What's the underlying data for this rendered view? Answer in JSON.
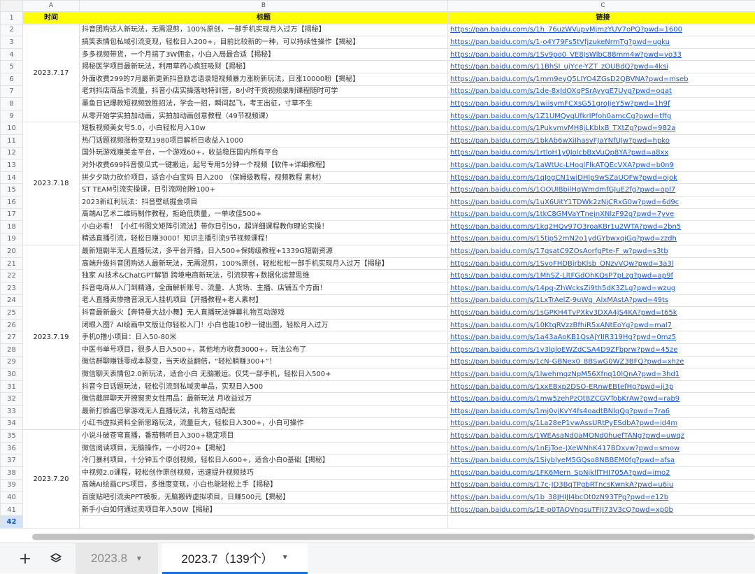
{
  "columns": [
    "A",
    "B",
    "C"
  ],
  "header": {
    "row_num": "1",
    "time": "时间",
    "title": "标题",
    "link": "链接"
  },
  "date_groups": [
    {
      "date": "2023.7.17",
      "start": 2,
      "span": 8
    },
    {
      "date": "2023.7.18",
      "start": 10,
      "span": 10
    },
    {
      "date": "2023.7.19",
      "start": 20,
      "span": 15
    },
    {
      "date": "2023.7.20",
      "start": 35,
      "span": 8
    }
  ],
  "rows": [
    {
      "n": "2",
      "title": "抖音团购达人新玩法，无需混剪，100%原创，一部手机实现月入过万【揭秘】",
      "link": "https://pan.baidu.com/s/1h_76uzWVupvMjmzYUV7oPQ?pwd=1600"
    },
    {
      "n": "3",
      "title": "搞笑表情包私域引流变现，轻松日入200+，目前比较新的一种，可以持续性操作【揭秘】",
      "link": "https://pan.baidu.com/s/1-o4Y79Fs5tVfjzukeNrmTg?pwd=ugku"
    },
    {
      "n": "4",
      "title": "多多视频带货，一个月搞了3W佣金，小白入局最合适【揭秘】",
      "link": "https://pan.baidu.com/s/1Sv9po0_VE8JsWlbC88mm4w?pwd=yo33"
    },
    {
      "n": "5",
      "title": "揭秘医学项目最新玩法，利用草药心疯狂吸财【揭秘】",
      "link": "https://pan.baidu.com/s/11BhSI_ujYce-YZT_zOUBdQ?pwd=4ksi"
    },
    {
      "n": "6",
      "title": "外面收费299的7月最新更新抖音励志语录短视频暴力涨粉新玩法，日涨10000粉【揭秘】",
      "link": "https://pan.baidu.com/s/1mm9eyQ5LIYO4ZGsD2QBVNA?pwd=mseb"
    },
    {
      "n": "7",
      "title": "老刘抖店商品卡流量，抖音小店实操落地特训营，8小时干货视频录制课程随时可学",
      "link": "https://pan.baidu.com/s/1de-8xJdOXqPSrAyygE7Uyg?pwd=ogat"
    },
    {
      "n": "8",
      "title": "墨鱼日记爆款短视频致胜招法，学会一招，瞬间起飞，考王出征，寸草不生",
      "link": "https://pan.baidu.com/s/1wiisymFCXsG51groJjeY5w?pwd=1h9f"
    },
    {
      "n": "9",
      "title": "从零开始学实拍加动画，实拍加动画创意教程（49节视频课）",
      "link": "https://pan.baidu.com/s/1Z1UMQvqUfkrIPfoh0amcCg?pwd=tffg"
    },
    {
      "n": "10",
      "title": "短板视频美女号5.0，小白轻松月入10w",
      "link": "https://pan.baidu.com/s/1PukvmvMH8jLKblxB_TXtZg?pwd=982a"
    },
    {
      "n": "11",
      "title": "热门话题视频涨粉变现1980项目解析日收益入1000",
      "link": "https://pan.baidu.com/s/1bkAb6wXiIhasvFJaYNfUJw?pwd=hpko"
    },
    {
      "n": "12",
      "title": "国外玩游戏赚美金平台，一个游戏60+，收益稳压国内所有平台",
      "link": "https://pan.baidu.com/s/1rtloH1y0JolcbBxVuQp8YA?pwd=a8xx"
    },
    {
      "n": "13",
      "title": "对外收费699抖音傻瓜式一键搬运，起号专用5分钟一个视频【软件+详细教程】",
      "link": "https://pan.baidu.com/s/1aWtUc-LHoglFlkATQEcVXA?pwd=b0n9"
    },
    {
      "n": "14",
      "title": "拼夕夕助力砍价项目，适合小白宝妈 日入200 （保姆级教程，视频教程 素材）",
      "link": "https://pan.baidu.com/s/1qJogCN1wjDHlp9wSZaUOFw?pwd=ojok"
    },
    {
      "n": "15",
      "title": "ST TEAM引流实操课，日引流网创粉100+",
      "link": "https://pan.baidu.com/s/1OOUIBbilHqWmdmfGJuE2fg?pwd=opl7"
    },
    {
      "n": "16",
      "title": "2023新红利玩法：抖音壁纸掘金项目",
      "link": "https://pan.baidu.com/s/1uX6UitY1TDWk2zNjCRxG0w?pwd=6d9c"
    },
    {
      "n": "17",
      "title": "高端AI艺术二维码制作教程，拒绝低质量，一单收佳500+",
      "link": "https://pan.baidu.com/s/1tkC8GMVaYTnejnXNlzF92g?pwd=7yve"
    },
    {
      "n": "18",
      "title": "小白必看！【小红书图文矩阵引流法】带你日引50，超详细课程教你理论实操！",
      "link": "https://pan.baidu.com/s/1kq2HQv97O3roaKBr1u2WTA?pwd=2bn5"
    },
    {
      "n": "19",
      "title": "精选直播引流，轻松日赚3000！知识主播引流9节视频课程！",
      "link": "https://pan.baidu.com/s/15tip52mN2o1ydGYbwxqiGg?pwd=zzdh"
    },
    {
      "n": "20",
      "title": "最新短剧半无人直播玩法，多平台开播，日入500+保姆级教程+1339G短剧资源",
      "link": "https://pan.baidu.com/s/17qsatC9ZOsAorfgPte-F_w?pwd=s3tb"
    },
    {
      "n": "21",
      "title": "高端升级抖音团购达人最新玩法，无需混剪，100%原创，轻松松松一部手机实现月入过万【揭秘】",
      "link": "https://pan.baidu.com/s/1SvoFHDBjrbKlsb_ONzvVQw?pwd=3a3l"
    },
    {
      "n": "22",
      "title": "独家 AI技术&ChatGPT解锁 跨境电商新玩法，引流获客+数据化运营思维",
      "link": "https://pan.baidu.com/s/1MhSZ-LltFGdOhKQsP7pLzg?pwd=ap9f"
    },
    {
      "n": "23",
      "title": "抖音电商从入门到精通，全面解析账号、流量、人货场、主播、店铺五个方面！",
      "link": "https://pan.baidu.com/s/14pq-ZhWcksZi9th5dK3ZLg?pwd=wzug"
    },
    {
      "n": "24",
      "title": "老人直播卖惨撸音浪无人挂机项目【开播教程+老人素材】",
      "link": "https://pan.baidu.com/s/1LxTrAelZ-9uWq_AlxMAstA?pwd=49ts"
    },
    {
      "n": "25",
      "title": "抖音最新最火【奔特曼大战小舞】无人直播玩法弹幕礼物互动游戏",
      "link": "https://pan.baidu.com/s/1sGPKH4TvPXkv3DXA4jS4KA?pwd=t65k"
    },
    {
      "n": "26",
      "title": "闭眼入图？AI绘画中文版让你轻松入门！小白也能10秒一键出图，轻松月入过万",
      "link": "https://pan.baidu.com/s/10KtqRVzzBfhiR5xANtEoYg?pwd=mal7"
    },
    {
      "n": "27",
      "title": "手机0撸小项目：日入50-80米",
      "link": "https://pan.baidu.com/s/1a43aAoKB1QsAjYIIR319Hg?pwd=0mz5"
    },
    {
      "n": "28",
      "title": "中医书单号项目，很多人日入500+，其他地方收费3000+，玩法公布了",
      "link": "https://pan.baidu.com/s/1v3lqloEWZdCSA4D9ZFbprw?pwd=45ze"
    },
    {
      "n": "29",
      "title": "微信群聊赚钱零成本裂变，当天收益翻倍，“轻松躺赚300+”！",
      "link": "https://pan.baidu.com/s/1cN-GBNex0_8BSwG0WZ3BFQ?pwd=xhze"
    },
    {
      "n": "30",
      "title": "微信聊天表情包2.0新玩法，适合小白 无脑搬运。仅凭一部手机，轻松日入500+",
      "link": "https://pan.baidu.com/s/1lwehmqzNpM56Xfnq10lQnA?pwd=3hd1"
    },
    {
      "n": "31",
      "title": "抖音今日话题玩法，轻松引流到私域卖单品，实现日入500",
      "link": "https://pan.baidu.com/s/1xxEBxp2DSO-ERnwEBtefHg?pwd=ji3p"
    },
    {
      "n": "32",
      "title": "微信截屏聊天开撩窗卖女性用品：最新玩法 月收益过万",
      "link": "https://pan.baidu.com/s/1mw5zehPzOt8ZCGVTobKrAw?pwd=rab9"
    },
    {
      "n": "33",
      "title": "最新打脸酱巴掌游戏无人直播玩法，礼物互动配套",
      "link": "https://pan.baidu.com/s/1mj0vjKvY4fs4oadtBNlqQg?pwd=7ra6"
    },
    {
      "n": "34",
      "title": "小红书虚拟资料全新思路玩法，流量巨大，轻松日入300+，小白可操作",
      "link": "https://pan.baidu.com/s/1La28eP1vwAssURtPyESdbA?pwd=id4m"
    },
    {
      "n": "35",
      "title": "小说斗破苍穹直播，番茄畅听日入300+稳定项目",
      "link": "https://pan.baidu.com/s/1WEAsaNd0aMONd0huefTANg?pwd=uwqz"
    },
    {
      "n": "36",
      "title": "微信阅读项目，无脑操作，一小时20+【揭秘】",
      "link": "https://pan.baidu.com/s/1nEjToe-JXeWNhK417BDxvw?pwd=smow"
    },
    {
      "n": "37",
      "title": "冷门暴利项目，十分钟五个原创视频，轻松日入600+，适合小白0基础【揭秘】",
      "link": "https://pan.baidu.com/s/1SiyblyeM5GQso8NBBEM0fg?pwd=afsa"
    },
    {
      "n": "38",
      "title": "中视频2.0课程，轻松创作原创视频，迅速提升视频技巧",
      "link": "https://pan.baidu.com/s/1FK6Mern_SpNjklfTHI705A?pwd=imo2"
    },
    {
      "n": "39",
      "title": "高端AI绘画CPS项目，多维度变现，小白也能轻松上手【揭秘】",
      "link": "https://pan.baidu.com/s/17c-JD3BqTPgbRTncsKwnkA?pwd=u6iu"
    },
    {
      "n": "40",
      "title": "百度贴吧引流卖PPT模板，无脑搬砖虚拟项目，日赚500元【揭秘】",
      "link": "https://pan.baidu.com/s/1b_38JHIJI4bcOt0zN93TPg?pwd=e12b"
    },
    {
      "n": "41",
      "title": "新手小白如何通过卖项目年入50W【揭秘】",
      "link": "https://pan.baidu.com/s/1E-p0TAQVngsuTFJI73V3cQ?pwd=xp0b"
    },
    {
      "n": "42",
      "title": "",
      "link": ""
    }
  ],
  "tabs": [
    {
      "label": "2023.8",
      "active": false
    },
    {
      "label": "2023.7（139个）",
      "active": true
    }
  ]
}
